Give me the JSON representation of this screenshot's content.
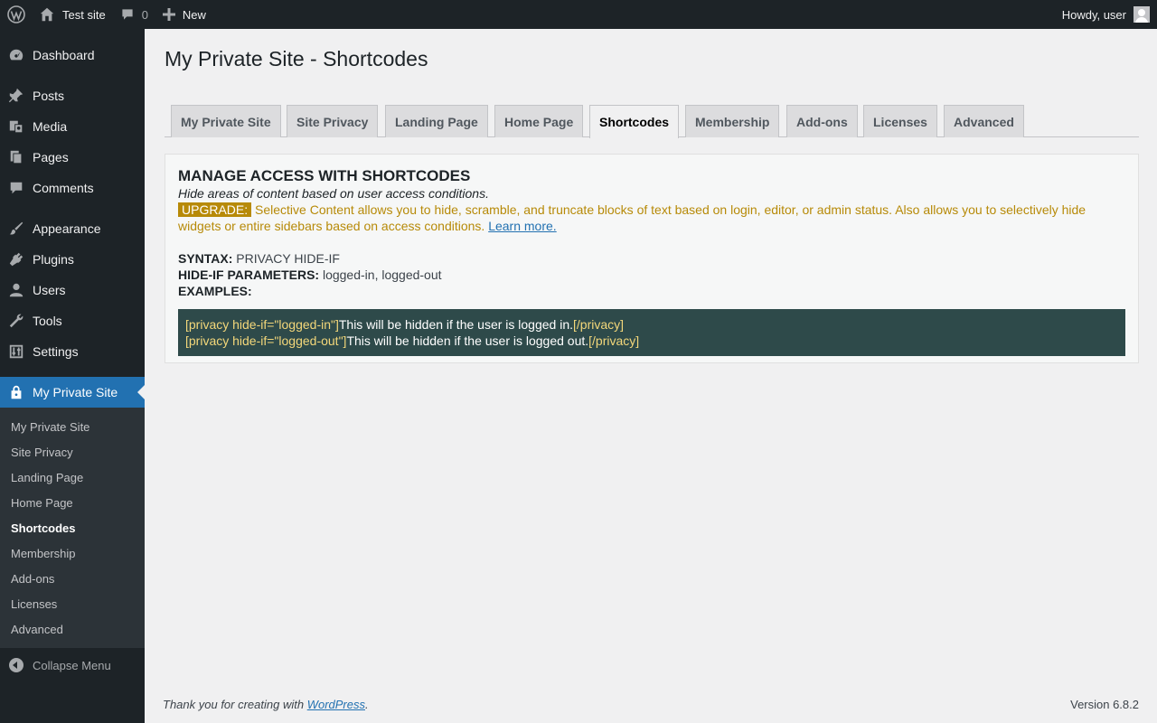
{
  "adminbar": {
    "site_name": "Test site",
    "comments_count": "0",
    "new_label": "New",
    "greeting": "Howdy, user"
  },
  "sidebar": {
    "items": [
      {
        "label": "Dashboard",
        "icon": "dashboard-icon"
      },
      {
        "label": "Posts",
        "icon": "pin-icon"
      },
      {
        "label": "Media",
        "icon": "media-icon"
      },
      {
        "label": "Pages",
        "icon": "pages-icon"
      },
      {
        "label": "Comments",
        "icon": "comment-icon"
      },
      {
        "label": "Appearance",
        "icon": "brush-icon"
      },
      {
        "label": "Plugins",
        "icon": "plug-icon"
      },
      {
        "label": "Users",
        "icon": "user-icon"
      },
      {
        "label": "Tools",
        "icon": "wrench-icon"
      },
      {
        "label": "Settings",
        "icon": "settings-icon"
      },
      {
        "label": "My Private Site",
        "icon": "lock-icon"
      }
    ],
    "submenu": [
      "My Private Site",
      "Site Privacy",
      "Landing Page",
      "Home Page",
      "Shortcodes",
      "Membership",
      "Add-ons",
      "Licenses",
      "Advanced"
    ],
    "collapse_label": "Collapse Menu"
  },
  "page": {
    "title": "My Private Site - Shortcodes",
    "tabs": [
      "My Private Site",
      "Site Privacy",
      "Landing Page",
      "Home Page",
      "Shortcodes",
      "Membership",
      "Add-ons",
      "Licenses",
      "Advanced"
    ],
    "active_tab": "Shortcodes"
  },
  "panel": {
    "heading": "MANAGE ACCESS WITH SHORTCODES",
    "subheading": "Hide areas of content based on user access conditions.",
    "upgrade_badge": "UPGRADE:",
    "upgrade_text": " Selective Content allows you to hide, scramble, and truncate blocks of text based on login, editor, or admin status. Also allows you to selectively hide widgets or entire sidebars based on access conditions. ",
    "learn_more": "Learn more.",
    "syntax_label": "SYNTAX:",
    "syntax_value": " PRIVACY HIDE-IF",
    "params_label": "HIDE-IF PARAMETERS:",
    "params_value": " logged-in, logged-out",
    "examples_label": "EXAMPLES:",
    "code": [
      {
        "open": "[privacy hide-if=\"logged-in\"]",
        "text": "This will be hidden if the user is logged in.",
        "close": "[/privacy]"
      },
      {
        "open": "[privacy hide-if=\"logged-out\"]",
        "text": "This will be hidden if the user is logged out.",
        "close": "[/privacy]"
      }
    ]
  },
  "footer": {
    "thanks_prefix": "Thank you for creating with ",
    "wordpress_link": "WordPress",
    "thanks_suffix": ".",
    "version": "Version 6.8.2"
  },
  "colors": {
    "adminbar_bg": "#1d2327",
    "accent": "#2271b1",
    "upgrade": "#b78a08",
    "code_bg": "#2e4a4a"
  }
}
